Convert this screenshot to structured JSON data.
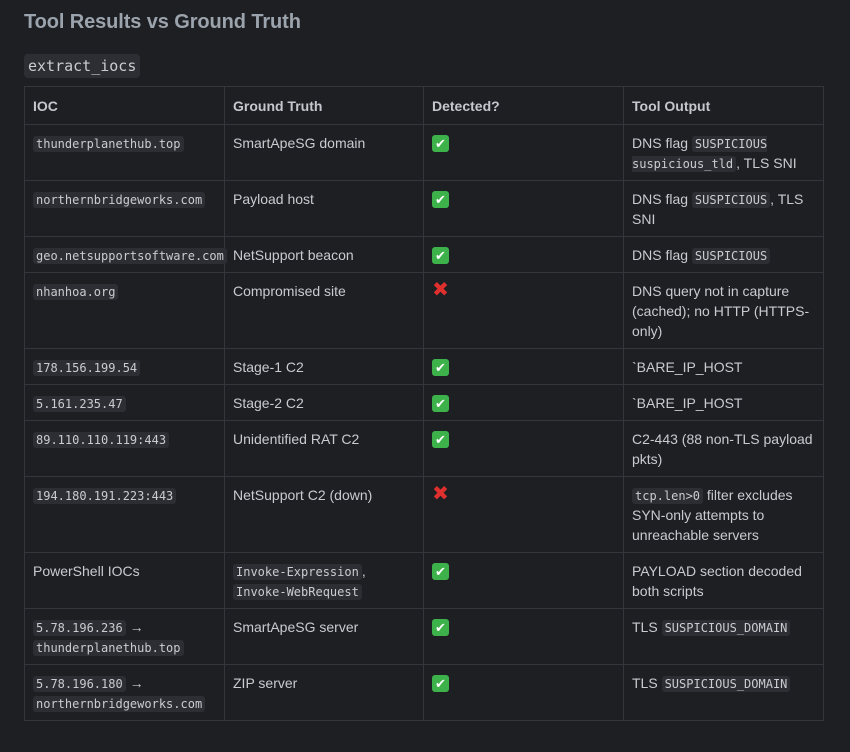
{
  "title": "Tool Results vs Ground Truth",
  "section": "extract_iocs",
  "columns": [
    "IOC",
    "Ground Truth",
    "Detected?",
    "Tool Output"
  ],
  "rows": [
    {
      "ioc": [
        {
          "t": "code",
          "v": "thunderplanethub.top"
        }
      ],
      "truth": [
        {
          "t": "text",
          "v": "SmartApeSG domain"
        }
      ],
      "detected": true,
      "output": [
        {
          "t": "text",
          "v": "DNS flag "
        },
        {
          "t": "code",
          "v": "SUSPICIOUS suspicious_tld"
        },
        {
          "t": "text",
          "v": ", TLS SNI"
        }
      ]
    },
    {
      "ioc": [
        {
          "t": "code",
          "v": "northernbridgeworks.com"
        }
      ],
      "truth": [
        {
          "t": "text",
          "v": "Payload host"
        }
      ],
      "detected": true,
      "output": [
        {
          "t": "text",
          "v": "DNS flag "
        },
        {
          "t": "code",
          "v": "SUSPICIOUS"
        },
        {
          "t": "text",
          "v": ", TLS SNI"
        }
      ]
    },
    {
      "ioc": [
        {
          "t": "code",
          "v": "geo.netsupportsoftware.com"
        }
      ],
      "truth": [
        {
          "t": "text",
          "v": "NetSupport beacon"
        }
      ],
      "detected": true,
      "output": [
        {
          "t": "text",
          "v": "DNS flag "
        },
        {
          "t": "code",
          "v": "SUSPICIOUS"
        }
      ]
    },
    {
      "ioc": [
        {
          "t": "code",
          "v": "nhanhoa.org"
        }
      ],
      "truth": [
        {
          "t": "text",
          "v": "Compromised site"
        }
      ],
      "detected": false,
      "output": [
        {
          "t": "text",
          "v": "DNS query not in capture (cached); no HTTP (HTTPS-only)"
        }
      ]
    },
    {
      "ioc": [
        {
          "t": "code",
          "v": "178.156.199.54"
        }
      ],
      "truth": [
        {
          "t": "text",
          "v": "Stage-1 C2"
        }
      ],
      "detected": true,
      "output": [
        {
          "t": "text",
          "v": "`BARE_IP_HOST"
        }
      ]
    },
    {
      "ioc": [
        {
          "t": "code",
          "v": "5.161.235.47"
        }
      ],
      "truth": [
        {
          "t": "text",
          "v": "Stage-2 C2"
        }
      ],
      "detected": true,
      "output": [
        {
          "t": "text",
          "v": "`BARE_IP_HOST"
        }
      ]
    },
    {
      "ioc": [
        {
          "t": "code",
          "v": "89.110.110.119:443"
        }
      ],
      "truth": [
        {
          "t": "text",
          "v": "Unidentified RAT C2"
        }
      ],
      "detected": true,
      "output": [
        {
          "t": "text",
          "v": "C2-443 (88 non-TLS payload pkts)"
        }
      ]
    },
    {
      "ioc": [
        {
          "t": "code",
          "v": "194.180.191.223:443"
        }
      ],
      "truth": [
        {
          "t": "text",
          "v": "NetSupport C2 (down)"
        }
      ],
      "detected": false,
      "output": [
        {
          "t": "code",
          "v": "tcp.len>0"
        },
        {
          "t": "text",
          "v": " filter excludes SYN-only attempts to unreachable servers"
        }
      ]
    },
    {
      "ioc": [
        {
          "t": "text",
          "v": "PowerShell IOCs"
        }
      ],
      "truth": [
        {
          "t": "code",
          "v": "Invoke-Expression"
        },
        {
          "t": "text",
          "v": ", "
        },
        {
          "t": "code",
          "v": "Invoke-WebRequest"
        }
      ],
      "detected": true,
      "output": [
        {
          "t": "text",
          "v": "PAYLOAD section decoded both scripts"
        }
      ]
    },
    {
      "ioc": [
        {
          "t": "code",
          "v": "5.78.196.236"
        },
        {
          "t": "text",
          "v": " → "
        },
        {
          "t": "code",
          "v": "thunderplanethub.top"
        }
      ],
      "truth": [
        {
          "t": "text",
          "v": "SmartApeSG server"
        }
      ],
      "detected": true,
      "output": [
        {
          "t": "text",
          "v": "TLS "
        },
        {
          "t": "code",
          "v": "SUSPICIOUS_DOMAIN"
        }
      ]
    },
    {
      "ioc": [
        {
          "t": "code",
          "v": "5.78.196.180"
        },
        {
          "t": "text",
          "v": " → "
        },
        {
          "t": "code",
          "v": "northernbridgeworks.com"
        }
      ],
      "truth": [
        {
          "t": "text",
          "v": "ZIP server"
        }
      ],
      "detected": true,
      "output": [
        {
          "t": "text",
          "v": "TLS "
        },
        {
          "t": "code",
          "v": "SUSPICIOUS_DOMAIN"
        }
      ]
    }
  ],
  "icons": {
    "detected_yes": "check-mark-icon",
    "detected_no": "cross-mark-icon"
  },
  "colors": {
    "background": "#1e1f23",
    "check": "#3db24a",
    "cross": "#e0302e"
  }
}
